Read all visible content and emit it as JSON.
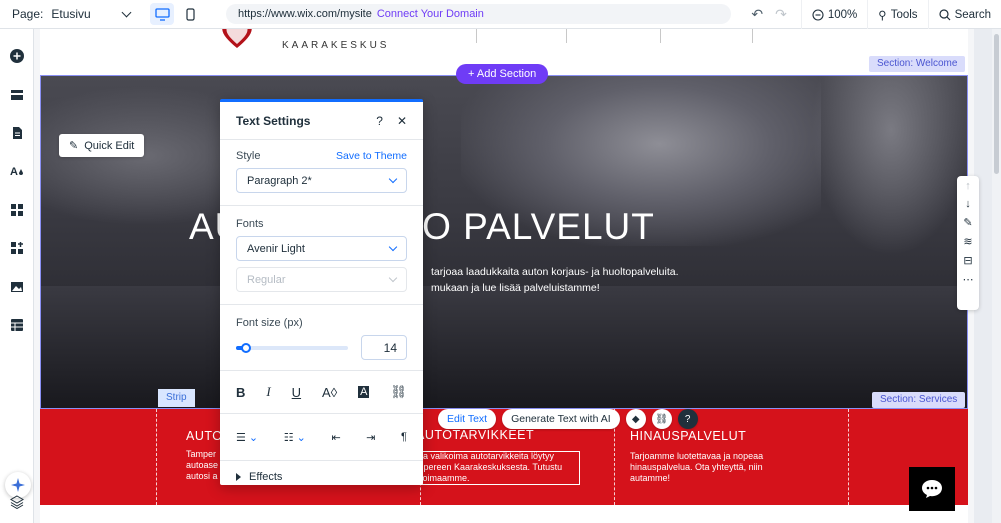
{
  "topbar": {
    "page_label": "Page:",
    "page_value": "Etusivu",
    "url": "https://www.wix.com/mysite",
    "connect_domain": "Connect Your Domain",
    "zoom": "100%",
    "tools": "Tools",
    "search": "Search"
  },
  "site": {
    "logo_text": "KAARAKESKUS",
    "section_welcome": "Section: Welcome",
    "section_services": "Section: Services",
    "add_section": "+ Add Section",
    "quick_edit": "Quick Edit",
    "hero_title": "AUTOHUOLTO PALVELUT",
    "hero_sub_1": "tarjoaa laadukkaita auton korjaus- ja huoltopalveluita.",
    "hero_sub_2": "mukaan ja lue lisää palveluistamme!",
    "strip_label": "Strip",
    "col1_title": "AUTO",
    "col1_text": "Tamper\nautoase\nautosi a",
    "col2_title": "AUTOTARVIKKEET",
    "col2_small": "xt",
    "col2_text": "aja valikoima autotarvikkeita löytyy\nmpereen Kaarakeskuksesta. Tutustu\nlkoimaamme.",
    "col3_title": "HINAUSPALVELUT",
    "col3_text": "Tarjoamme luotettavaa ja nopeaa\nhinauspalvelua. Ota yhteyttä, niin\nautamme!",
    "edit_text": "Edit Text",
    "generate_ai": "Generate Text with AI"
  },
  "panel": {
    "title": "Text Settings",
    "help": "?",
    "close": "✕",
    "style_label": "Style",
    "save_theme": "Save to Theme",
    "style_value": "Paragraph 2*",
    "fonts_label": "Fonts",
    "font_value": "Avenir Light",
    "weight_value": "Regular",
    "font_size_label": "Font size (px)",
    "font_size": "14",
    "font_size_fraction": 0.08,
    "effects": "Effects"
  },
  "colors": {
    "accent": "#116dff",
    "wix_purple": "#6f3cf6",
    "strip_red": "#d5121b"
  }
}
